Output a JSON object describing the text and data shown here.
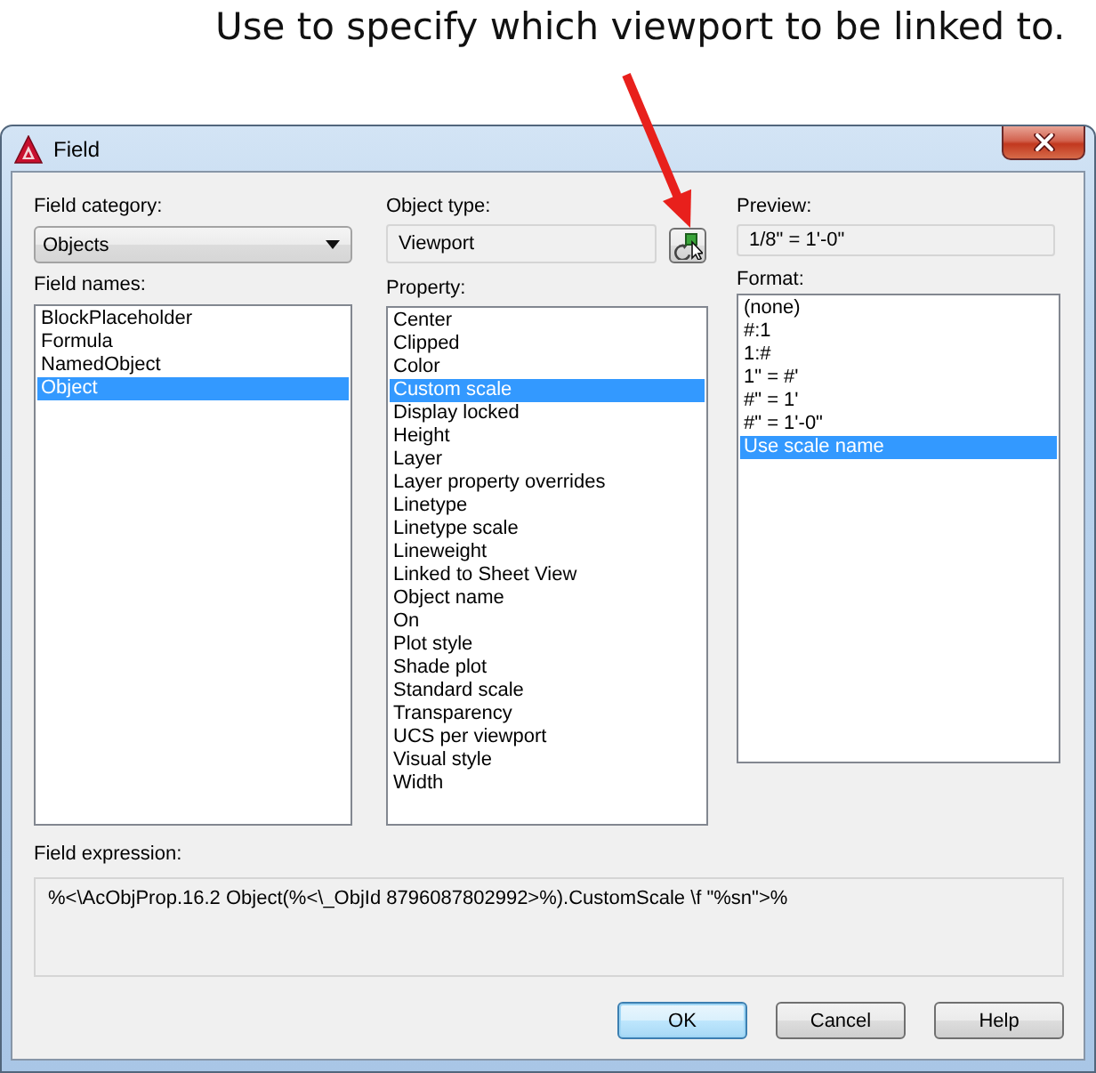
{
  "annotation": {
    "text": "Use to specify which viewport to be linked to."
  },
  "window": {
    "title": "Field"
  },
  "field_category": {
    "label": "Field category:",
    "value": "Objects"
  },
  "field_names": {
    "label": "Field names:",
    "items": [
      {
        "label": "BlockPlaceholder",
        "selected": false
      },
      {
        "label": "Formula",
        "selected": false
      },
      {
        "label": "NamedObject",
        "selected": false
      },
      {
        "label": "Object",
        "selected": true
      }
    ]
  },
  "object_type": {
    "label": "Object type:",
    "value": "Viewport"
  },
  "property": {
    "label": "Property:",
    "items": [
      {
        "label": "Center",
        "selected": false
      },
      {
        "label": "Clipped",
        "selected": false
      },
      {
        "label": "Color",
        "selected": false
      },
      {
        "label": "Custom scale",
        "selected": true
      },
      {
        "label": "Display locked",
        "selected": false
      },
      {
        "label": "Height",
        "selected": false
      },
      {
        "label": "Layer",
        "selected": false
      },
      {
        "label": "Layer property overrides",
        "selected": false
      },
      {
        "label": "Linetype",
        "selected": false
      },
      {
        "label": "Linetype scale",
        "selected": false
      },
      {
        "label": "Lineweight",
        "selected": false
      },
      {
        "label": "Linked to Sheet View",
        "selected": false
      },
      {
        "label": "Object name",
        "selected": false
      },
      {
        "label": "On",
        "selected": false
      },
      {
        "label": "Plot style",
        "selected": false
      },
      {
        "label": "Shade plot",
        "selected": false
      },
      {
        "label": "Standard scale",
        "selected": false
      },
      {
        "label": "Transparency",
        "selected": false
      },
      {
        "label": "UCS per viewport",
        "selected": false
      },
      {
        "label": "Visual style",
        "selected": false
      },
      {
        "label": "Width",
        "selected": false
      }
    ]
  },
  "preview": {
    "label": "Preview:",
    "value": "1/8\" = 1'-0\""
  },
  "format": {
    "label": "Format:",
    "items": [
      {
        "label": "(none)",
        "selected": false
      },
      {
        "label": "#:1",
        "selected": false
      },
      {
        "label": "1:#",
        "selected": false
      },
      {
        "label": "1\" = #'",
        "selected": false
      },
      {
        "label": "#\" = 1'",
        "selected": false
      },
      {
        "label": "#\" = 1'-0\"",
        "selected": false
      },
      {
        "label": "Use scale name",
        "selected": true
      }
    ]
  },
  "field_expression": {
    "label": "Field expression:",
    "value": "%<\\AcObjProp.16.2 Object(%<\\_ObjId 8796087802992>%).CustomScale \\f \"%sn\">%"
  },
  "buttons": [
    {
      "label": "OK",
      "default": true
    },
    {
      "label": "Cancel",
      "default": false
    },
    {
      "label": "Help",
      "default": false
    }
  ]
}
